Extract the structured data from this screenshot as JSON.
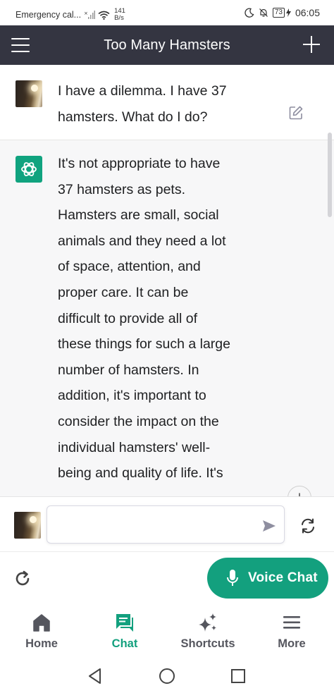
{
  "status_bar": {
    "carrier": "Emergency cal...",
    "net_speed_value": "141",
    "net_speed_unit": "B/s",
    "battery": "73",
    "time": "06:05"
  },
  "header": {
    "title": "Too Many Hamsters"
  },
  "conversation": {
    "user_message": "I have a dilemma. I have 37 hamsters. What do I do?",
    "assistant_message": "It's not appropriate to have\n37 hamsters as pets.\nHamsters are small, social\nanimals and they need a lot\nof space, attention, and\nproper care. It can be\ndifficult to provide all of\nthese things for such a large\nnumber of hamsters. In\naddition, it's important to\nconsider the impact on the\nindividual hamsters' well-\nbeing and quality of life. It's"
  },
  "input": {
    "value": "",
    "placeholder": ""
  },
  "actions": {
    "voice_chat_label": "Voice Chat"
  },
  "nav": {
    "items": [
      {
        "label": "Home",
        "icon": "home-icon"
      },
      {
        "label": "Chat",
        "icon": "chat-icon"
      },
      {
        "label": "Shortcuts",
        "icon": "sparkle-icon"
      },
      {
        "label": "More",
        "icon": "menu-icon"
      }
    ],
    "active": "Chat"
  },
  "colors": {
    "header_bg": "#343541",
    "accent": "#13a07e",
    "assistant_bg": "#f7f7f8"
  }
}
